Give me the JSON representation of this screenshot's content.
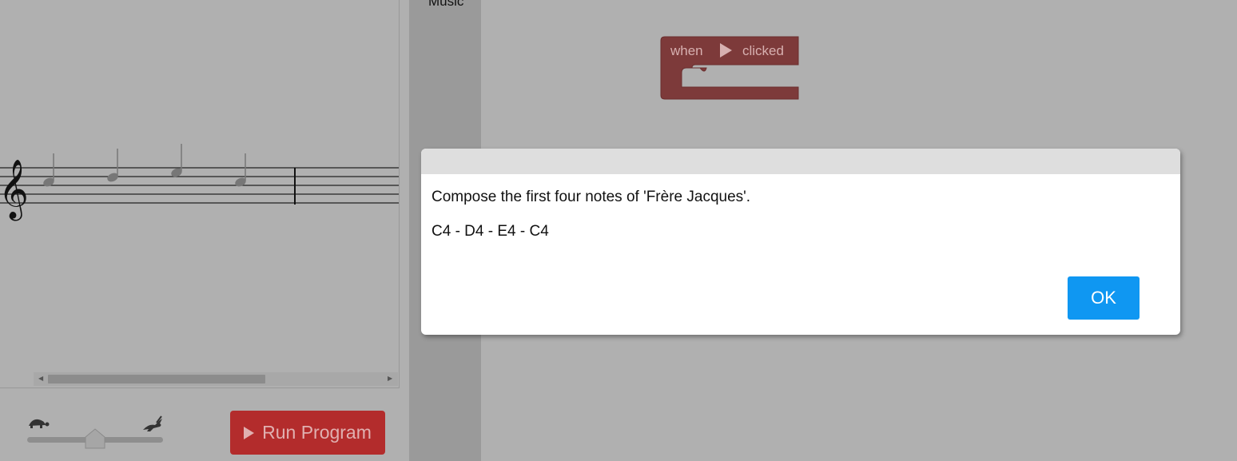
{
  "toolbox": {
    "category_label": "Music"
  },
  "block": {
    "word_when": "when",
    "word_clicked": "clicked",
    "color": "#7d3a3a"
  },
  "controls": {
    "run_label": "Run Program"
  },
  "dialog": {
    "message": "Compose the first four notes of 'Frère Jacques'.",
    "notes": "C4 - D4 - E4 - C4",
    "ok_label": "OK"
  },
  "colors": {
    "run_button": "#b32c2c",
    "ok_button": "#0f97f2",
    "background": "#b0b0b0"
  },
  "icons": [
    "treble-clef-icon",
    "quarter-note-icon",
    "turtle-icon",
    "rabbit-icon",
    "play-icon"
  ]
}
